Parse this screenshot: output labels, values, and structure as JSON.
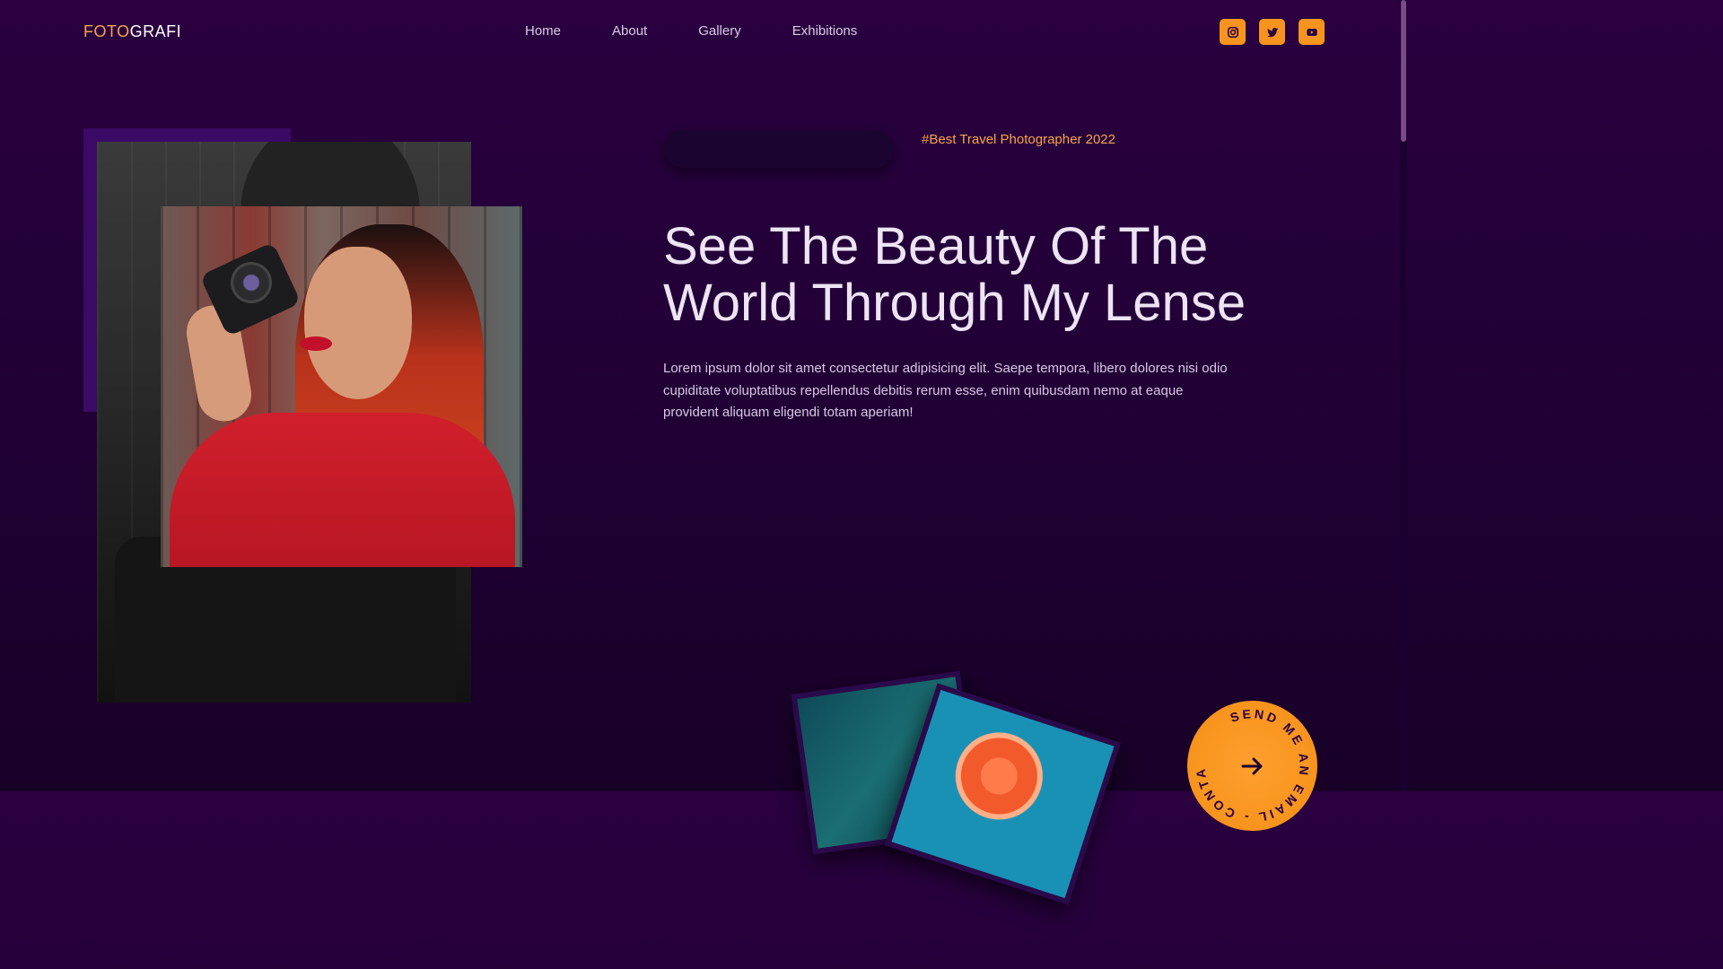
{
  "brand": {
    "logo_part1": "FOTO",
    "logo_part2": "GRAFI",
    "accent_color": "#f5a54a"
  },
  "nav": {
    "items": [
      "Home",
      "About",
      "Gallery",
      "Exhibitions"
    ]
  },
  "socials": [
    {
      "icon": "instagram-icon"
    },
    {
      "icon": "twitter-icon"
    },
    {
      "icon": "youtube-icon"
    }
  ],
  "hero": {
    "tagline": "#Best Travel Photographer 2022",
    "title_line1": "See The Beauty Of The",
    "title_line2": "World Through My Lense",
    "description": "Lorem ipsum dolor sit amet consectetur adipisicing elit. Saepe tempora, libero dolores nisi odio cupiditate voluptatibus repellendus debitis rerum esse, enim quibusdam nemo at eaque provident aliquam eligendi totam aperiam!"
  },
  "contact": {
    "circle_text": "SEND ME AN EMAIL - CONTACT - ",
    "icon": "arrow-right-icon"
  },
  "colors": {
    "background": "#230037",
    "orange": "#f7941d",
    "accent_purple": "#3a0a66"
  }
}
